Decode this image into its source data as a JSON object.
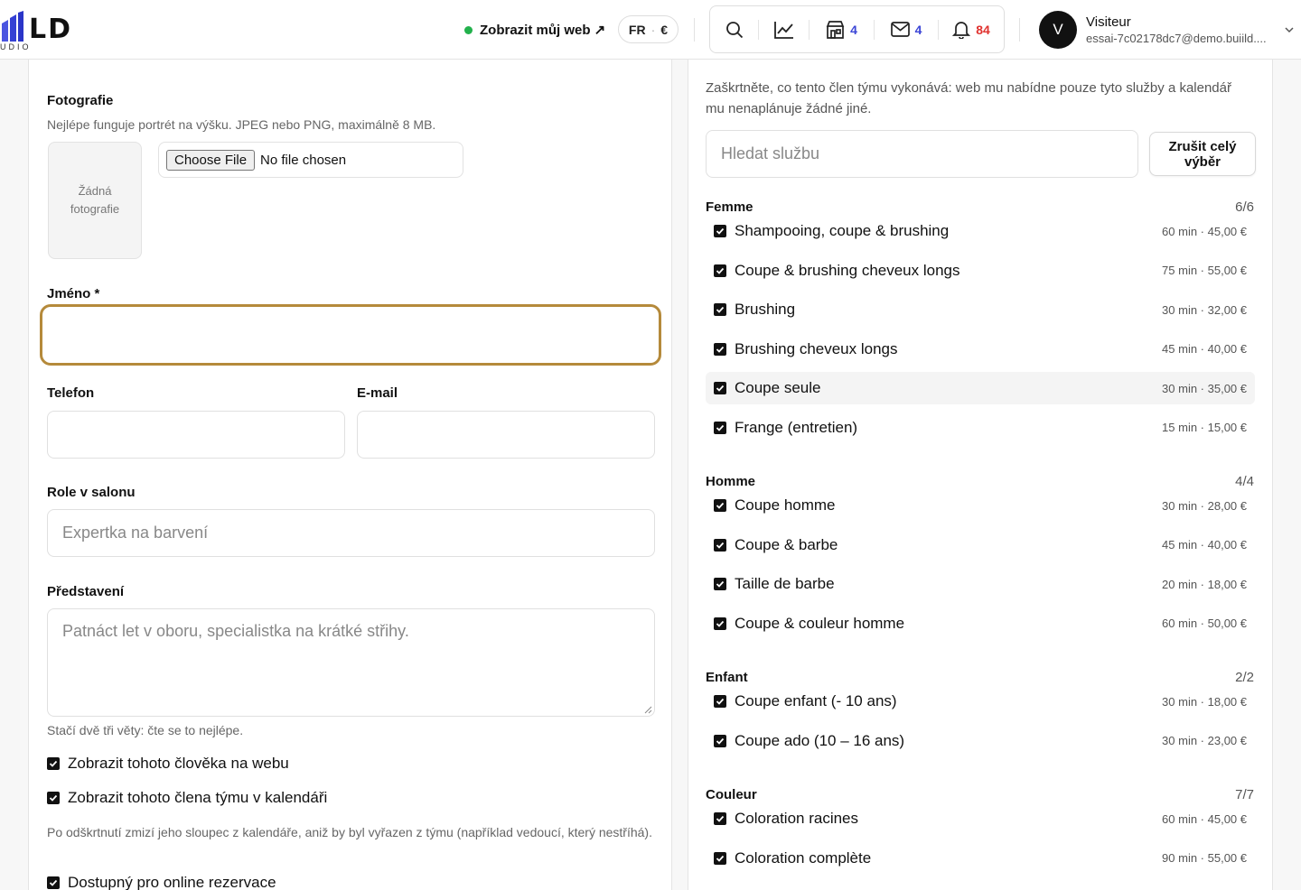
{
  "header": {
    "logo_text": "LD",
    "logo_sub": "UDIO",
    "view_site_label": "Zobrazit můj web ↗",
    "lang": "FR",
    "currency": "€",
    "counts": {
      "bookings": "4",
      "messages": "4",
      "notifications": "84"
    },
    "user": {
      "initial": "V",
      "name": "Visiteur",
      "email": "essai-7c02178dc7@demo.buiild...."
    }
  },
  "form": {
    "photo": {
      "label": "Fotografie",
      "hint": "Nejlépe funguje portrét na výšku. JPEG nebo PNG, maximálně 8 MB.",
      "empty": "Žádná fotografie",
      "choose_label": "Choose File",
      "no_file": "No file chosen"
    },
    "name": {
      "label": "Jméno *",
      "value": ""
    },
    "phone": {
      "label": "Telefon",
      "value": ""
    },
    "email": {
      "label": "E-mail",
      "value": ""
    },
    "role": {
      "label": "Role v salonu",
      "placeholder": "Expertka na barvení"
    },
    "intro": {
      "label": "Představení",
      "placeholder": "Patnáct let v oboru, specialistka na krátké střihy.",
      "hint": "Stačí dvě tři věty: čte se to nejlépe."
    },
    "checks": {
      "show_web": "Zobrazit tohoto člověka na webu",
      "show_calendar": "Zobrazit tohoto člena týmu v kalendáři",
      "calendar_hint": "Po odškrtnutí zmizí jeho sloupec z kalendáře, aniž by byl vyřazen z týmu (například vedoucí, který nestříhá).",
      "online": "Dostupný pro online rezervace"
    }
  },
  "services": {
    "description": "Zaškrtněte, co tento člen týmu vykonává: web mu nabídne pouze tyto služby a kalendář mu nenaplánuje žádné jiné.",
    "search_placeholder": "Hledat službu",
    "clear_label": "Zrušit celý výběr",
    "categories": [
      {
        "name": "Femme",
        "count": "6/6",
        "items": [
          {
            "name": "Shampooing, coupe & brushing",
            "meta": "60 min · 45,00 €",
            "checked": true
          },
          {
            "name": "Coupe & brushing cheveux longs",
            "meta": "75 min · 55,00 €",
            "checked": true
          },
          {
            "name": "Brushing",
            "meta": "30 min · 32,00 €",
            "checked": true
          },
          {
            "name": "Brushing cheveux longs",
            "meta": "45 min · 40,00 €",
            "checked": true
          },
          {
            "name": "Coupe seule",
            "meta": "30 min · 35,00 €",
            "checked": true
          },
          {
            "name": "Frange (entretien)",
            "meta": "15 min · 15,00 €",
            "checked": true
          }
        ]
      },
      {
        "name": "Homme",
        "count": "4/4",
        "items": [
          {
            "name": "Coupe homme",
            "meta": "30 min · 28,00 €",
            "checked": true
          },
          {
            "name": "Coupe & barbe",
            "meta": "45 min · 40,00 €",
            "checked": true
          },
          {
            "name": "Taille de barbe",
            "meta": "20 min · 18,00 €",
            "checked": true
          },
          {
            "name": "Coupe & couleur homme",
            "meta": "60 min · 50,00 €",
            "checked": true
          }
        ]
      },
      {
        "name": "Enfant",
        "count": "2/2",
        "items": [
          {
            "name": "Coupe enfant (- 10 ans)",
            "meta": "30 min · 18,00 €",
            "checked": true
          },
          {
            "name": "Coupe ado (10 – 16 ans)",
            "meta": "30 min · 23,00 €",
            "checked": true
          }
        ]
      },
      {
        "name": "Couleur",
        "count": "7/7",
        "items": [
          {
            "name": "Coloration racines",
            "meta": "60 min · 45,00 €",
            "checked": true
          },
          {
            "name": "Coloration complète",
            "meta": "90 min · 55,00 €",
            "checked": true
          }
        ]
      }
    ]
  },
  "colors": {
    "accent_focus": "#b58a3b",
    "online_dot": "#22b14c",
    "count_blue": "#3b45d6",
    "count_red": "#e0322f"
  }
}
